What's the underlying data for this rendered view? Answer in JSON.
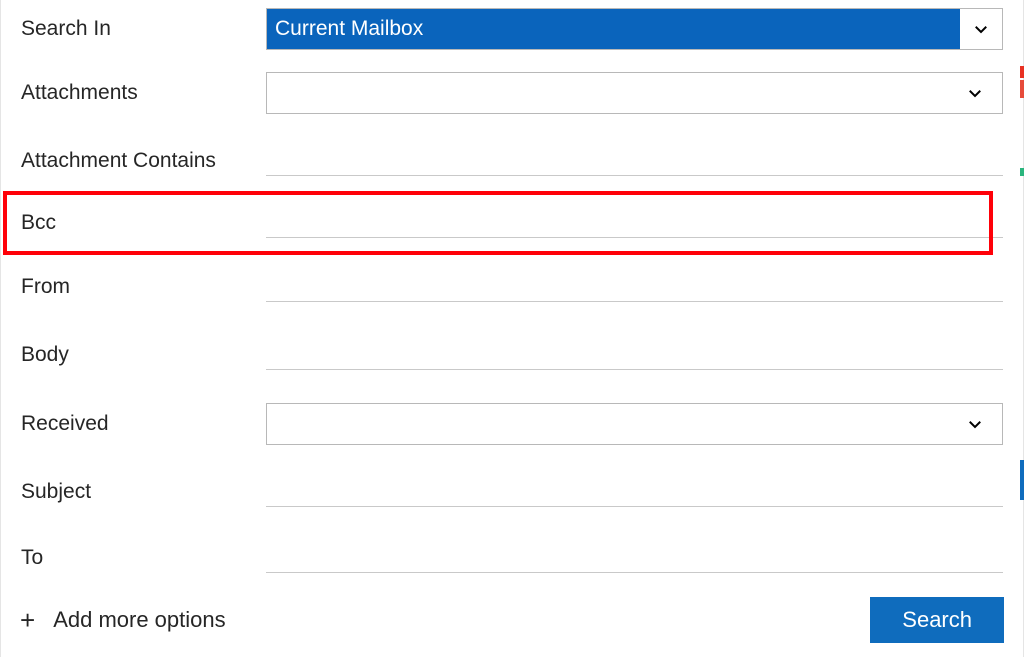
{
  "rows": {
    "searchIn": {
      "label": "Search In",
      "value": "Current Mailbox"
    },
    "attachments": {
      "label": "Attachments",
      "value": ""
    },
    "attachmentContains": {
      "label": "Attachment Contains",
      "value": ""
    },
    "bcc": {
      "label": "Bcc",
      "value": ""
    },
    "from": {
      "label": "From",
      "value": ""
    },
    "body": {
      "label": "Body",
      "value": ""
    },
    "received": {
      "label": "Received",
      "value": ""
    },
    "subject": {
      "label": "Subject",
      "value": ""
    },
    "to": {
      "label": "To",
      "value": ""
    }
  },
  "bottom": {
    "addMore": "Add more options",
    "searchBtn": "Search"
  },
  "icons": {
    "chevron": "chevron-down-icon",
    "plus": "plus-icon"
  },
  "colors": {
    "accent": "#0f6cbd",
    "selectionBg": "#0a64bc",
    "highlightBorder": "#ff0008"
  }
}
